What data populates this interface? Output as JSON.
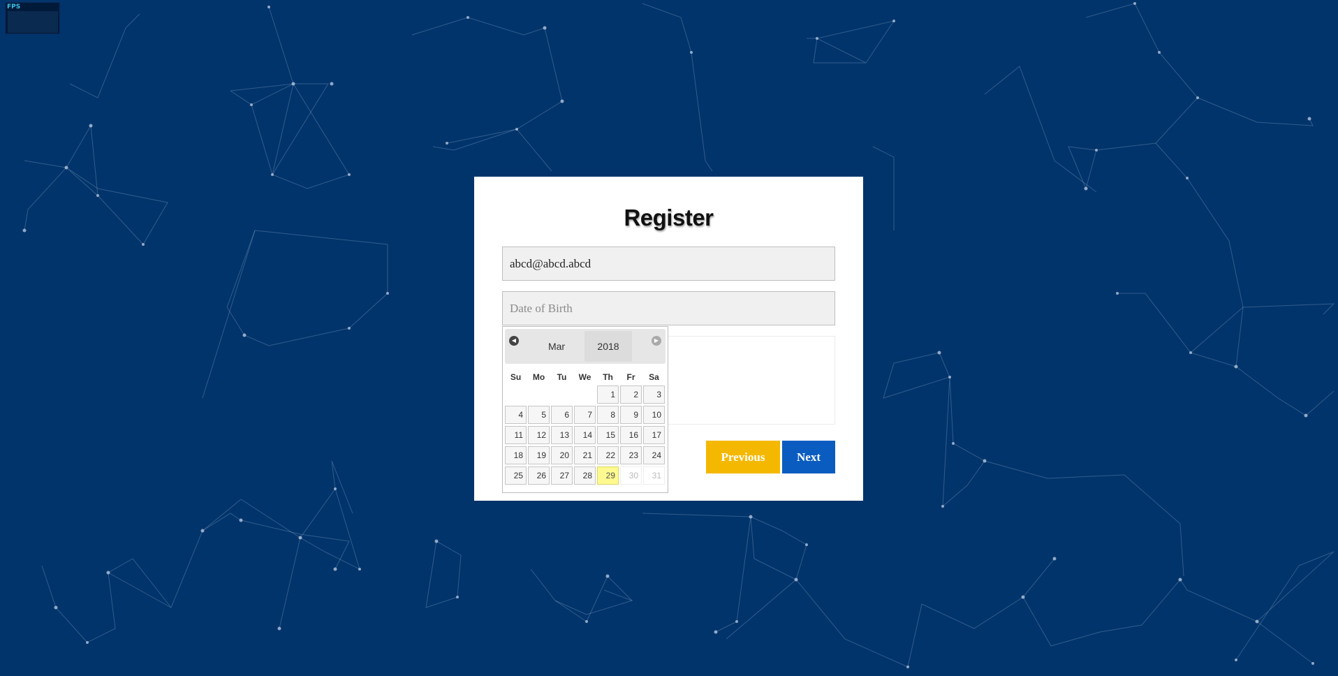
{
  "fps": {
    "label": "FPS"
  },
  "form": {
    "title": "Register",
    "email_value": "abcd@abcd.abcd",
    "dob_placeholder": "Date of Birth",
    "previous_label": "Previous",
    "next_label": "Next"
  },
  "datepicker": {
    "month": "Mar",
    "year": "2018",
    "weekdays": [
      "Su",
      "Mo",
      "Tu",
      "We",
      "Th",
      "Fr",
      "Sa"
    ],
    "leading_blanks": 4,
    "days": [
      "1",
      "2",
      "3",
      "4",
      "5",
      "6",
      "7",
      "8",
      "9",
      "10",
      "11",
      "12",
      "13",
      "14",
      "15",
      "16",
      "17",
      "18",
      "19",
      "20",
      "21",
      "22",
      "23",
      "24",
      "25",
      "26",
      "27",
      "28",
      "29",
      "30",
      "31"
    ],
    "today": "29",
    "disabled_days": [
      "30",
      "31"
    ]
  },
  "colors": {
    "background": "#01346b",
    "previous_button": "#f5b800",
    "next_button": "#0a5cc0",
    "today_highlight": "#fffa90"
  }
}
